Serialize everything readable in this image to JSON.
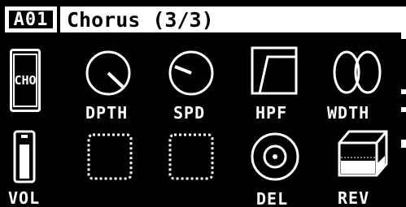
{
  "header": {
    "slot": "A01",
    "title": "Chorus (3/3)"
  },
  "row1": {
    "effect_tag": "CHO",
    "params": [
      {
        "label": "DPTH",
        "icon": "depth-knob-icon"
      },
      {
        "label": "SPD",
        "icon": "speed-knob-icon"
      },
      {
        "label": "HPF",
        "icon": "highpass-filter-icon"
      },
      {
        "label": "WDTH",
        "icon": "width-icon"
      }
    ]
  },
  "row2": {
    "params": [
      {
        "label": "VOL",
        "icon": "volume-fader-icon"
      },
      {
        "label": "",
        "icon": "empty-slot-icon"
      },
      {
        "label": "",
        "icon": "empty-slot-icon"
      },
      {
        "label": "DEL",
        "icon": "delay-send-icon"
      },
      {
        "label": "REV",
        "icon": "reverb-send-icon"
      }
    ]
  },
  "colors": {
    "background": "#000000",
    "foreground": "#ffffff"
  }
}
